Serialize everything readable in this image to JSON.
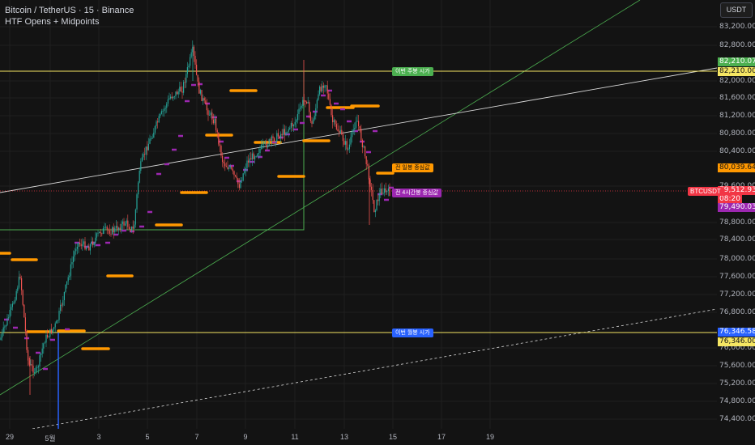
{
  "header": {
    "symbol_title": "Bitcoin / TetherUS · 15 · Binance",
    "indicator_name": "HTF Opens + Midpoints"
  },
  "currency_button": "USDT",
  "price_axis": {
    "ticks": [
      "83,200.00",
      "82,800.00",
      "82,000.00",
      "81,600.00",
      "81,200.00",
      "80,800.00",
      "80,400.00",
      "79,600.00",
      "78,800.00",
      "78,400.00",
      "78,000.00",
      "77,600.00",
      "77,200.00",
      "76,800.00",
      "76,000.00",
      "75,600.00",
      "75,200.00",
      "74,800.00",
      "74,400.00"
    ],
    "labels": {
      "weekly_open_green": "82,210.07",
      "weekly_open_yellow": "82,210.00",
      "daily_mid": "80,039.64",
      "last_price": "79,512.93",
      "countdown": "08:20",
      "h4_mid": "79,490.03",
      "monthly_open_blue": "76,346.58",
      "monthly_open_yellow": "76,346.00"
    },
    "symbol_label": "BTCUSDT"
  },
  "time_axis": {
    "ticks": [
      "29",
      "5월",
      "3",
      "5",
      "7",
      "9",
      "11",
      "13",
      "15",
      "17",
      "19"
    ]
  },
  "annotations": {
    "weekly_open": "이번 주봉 시가",
    "daily_mid": "전 일봉 중심값",
    "h4_mid": "전 4시간봉 중심값",
    "monthly_open": "이번 월봉 시가"
  },
  "colors": {
    "background": "#131313",
    "up": "#26a69a",
    "down": "#ef5350",
    "weekly": "#4caf50",
    "daily": "#ff9800",
    "h4": "#9c27b0",
    "monthly": "#2962ff",
    "level_line": "#f5e663",
    "last_price": "#f23645"
  }
}
